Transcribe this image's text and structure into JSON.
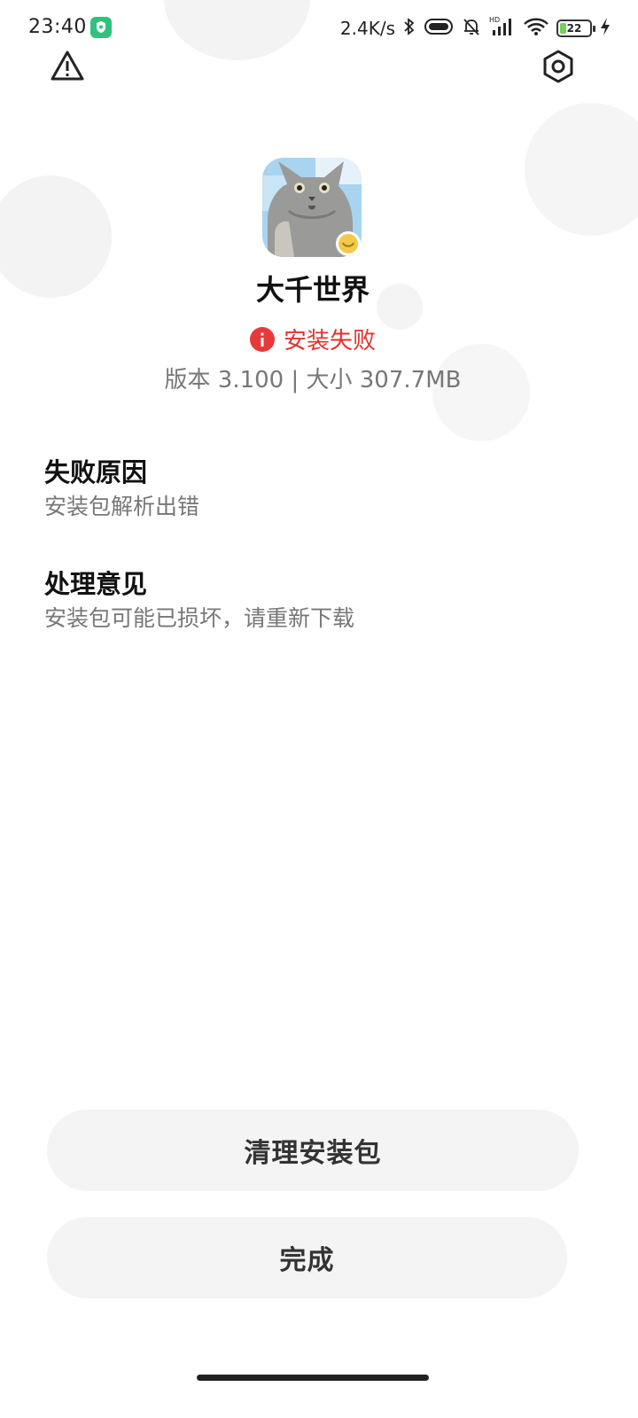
{
  "status_bar": {
    "time": "23:40",
    "net_speed": "2.4K/s",
    "battery_level": "22",
    "battery_fraction": 0.22
  },
  "icons": {
    "warning": "warning-triangle-icon",
    "settings": "settings-hexagon-icon",
    "error": "error-info-icon"
  },
  "app": {
    "name": "大千世界",
    "install_status": "安装失败",
    "version_info": "版本 3.100 | 大小 307.7MB"
  },
  "failure": {
    "title": "失败原因",
    "reason": "安装包解析出错"
  },
  "advice": {
    "title": "处理意见",
    "text": "安装包可能已损坏，请重新下载"
  },
  "buttons": {
    "clean": "清理安装包",
    "done": "完成"
  },
  "colors": {
    "error": "#e2322e",
    "button_bg": "#f4f4f4"
  }
}
